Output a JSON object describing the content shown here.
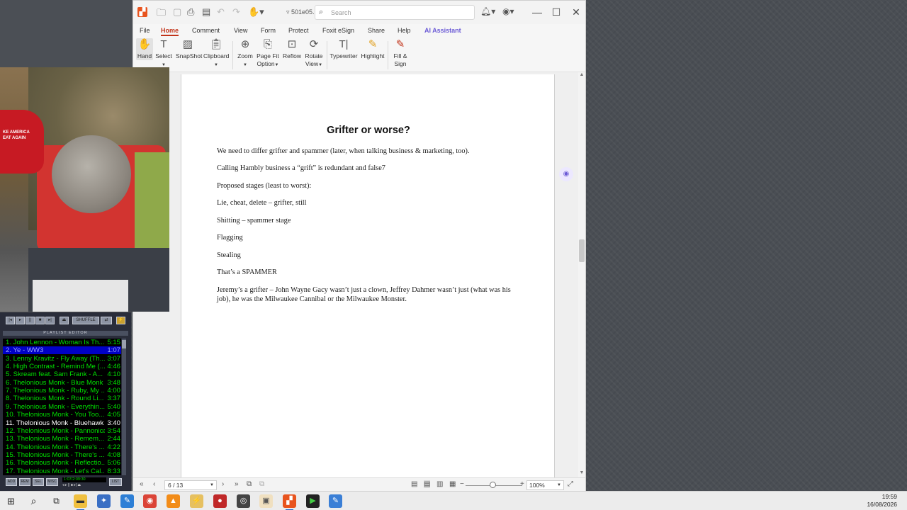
{
  "window": {
    "filename": "501e05.pdf",
    "search_placeholder": "Search"
  },
  "menu": [
    "File",
    "Home",
    "Comment",
    "View",
    "Form",
    "Protect",
    "Foxit eSign",
    "Share",
    "Help",
    "AI Assistant"
  ],
  "ribbon": {
    "hand": "Hand",
    "select": "Select",
    "snapshot": "SnapShot",
    "clipboard": "Clipboard",
    "zoom": "Zoom",
    "page_fit_1": "Page Fit",
    "page_fit_2": "Option",
    "reflow": "Reflow",
    "rotate_1": "Rotate",
    "rotate_2": "View",
    "typewriter": "Typewriter",
    "highlight": "Highlight",
    "fill_1": "Fill &",
    "fill_2": "Sign"
  },
  "document": {
    "title": "Grifter or worse?",
    "paragraphs": [
      "We need to differ grifter and spammer (later, when talking business & marketing, too).",
      "Calling Hambly business a “grift” is redundant and false7",
      "Proposed stages (least to worst):",
      "Lie, cheat, delete – grifter, still",
      "Shitting – spammer stage",
      "Flagging",
      "Stealing",
      "That’s a SPAMMER",
      "Jeremy’s a grifter – John Wayne Gacy wasn’t just a clown, Jeffrey Dahmer wasn’t just (what was his job), he was the Milwaukee Cannibal or the Milwaukee Monster."
    ]
  },
  "status": {
    "page": "6 / 13",
    "zoom": "100%"
  },
  "webcam": {
    "hat_text_1": "KE AMERICA",
    "hat_text_2": "EAT AGAIN"
  },
  "winamp": {
    "header": "PLAYLIST EDITOR",
    "shuffle": "SHUFFLE",
    "time": "1:07/2:09:30",
    "playlist": [
      {
        "title": "1. John Lennon - Woman Is Th...",
        "dur": "5:15"
      },
      {
        "title": "2. Ye - WW3",
        "dur": "1:07"
      },
      {
        "title": "3. Lenny Kravitz - Fly Away (Th...",
        "dur": "3:07"
      },
      {
        "title": "4. High Contrast - Remind Me (...",
        "dur": "4:46"
      },
      {
        "title": "5. Skream feat. Sam Frank - A...",
        "dur": "4:10"
      },
      {
        "title": "6. Thelonious Monk - Blue Monk",
        "dur": "3:48"
      },
      {
        "title": "7. Thelonious Monk - Ruby, My ...",
        "dur": "4:00"
      },
      {
        "title": "8. Thelonious Monk - Round Li...",
        "dur": "3:37"
      },
      {
        "title": "9. Thelonious Monk - Everythin...",
        "dur": "5:40"
      },
      {
        "title": "10. Thelonious Monk - You Too...",
        "dur": "4:05"
      },
      {
        "title": "11. Thelonious Monk - Bluehawk",
        "dur": "3:40"
      },
      {
        "title": "12. Thelonious Monk - Pannonica",
        "dur": "3:54"
      },
      {
        "title": "13. Thelonious Monk - Remem...",
        "dur": "2:44"
      },
      {
        "title": "14. Thelonious Monk - There's ...",
        "dur": "4:22"
      },
      {
        "title": "15. Thelonious Monk - There's ...",
        "dur": "4:08"
      },
      {
        "title": "16. Thelonious Monk - Reflectio...",
        "dur": "5:06"
      },
      {
        "title": "17. Thelonious Monk - Let's Cal...",
        "dur": "8:33"
      }
    ],
    "buttons": [
      "ADD",
      "REM",
      "SEL",
      "MISC",
      "LIST"
    ]
  },
  "taskbar": {
    "time": "19:59",
    "date": "16/08/2026"
  },
  "colors": {
    "accent": "#c2341a",
    "ai": "#6b5ad6",
    "playlist_text": "#00e000",
    "playlist_selected_bg": "#0000c6"
  }
}
